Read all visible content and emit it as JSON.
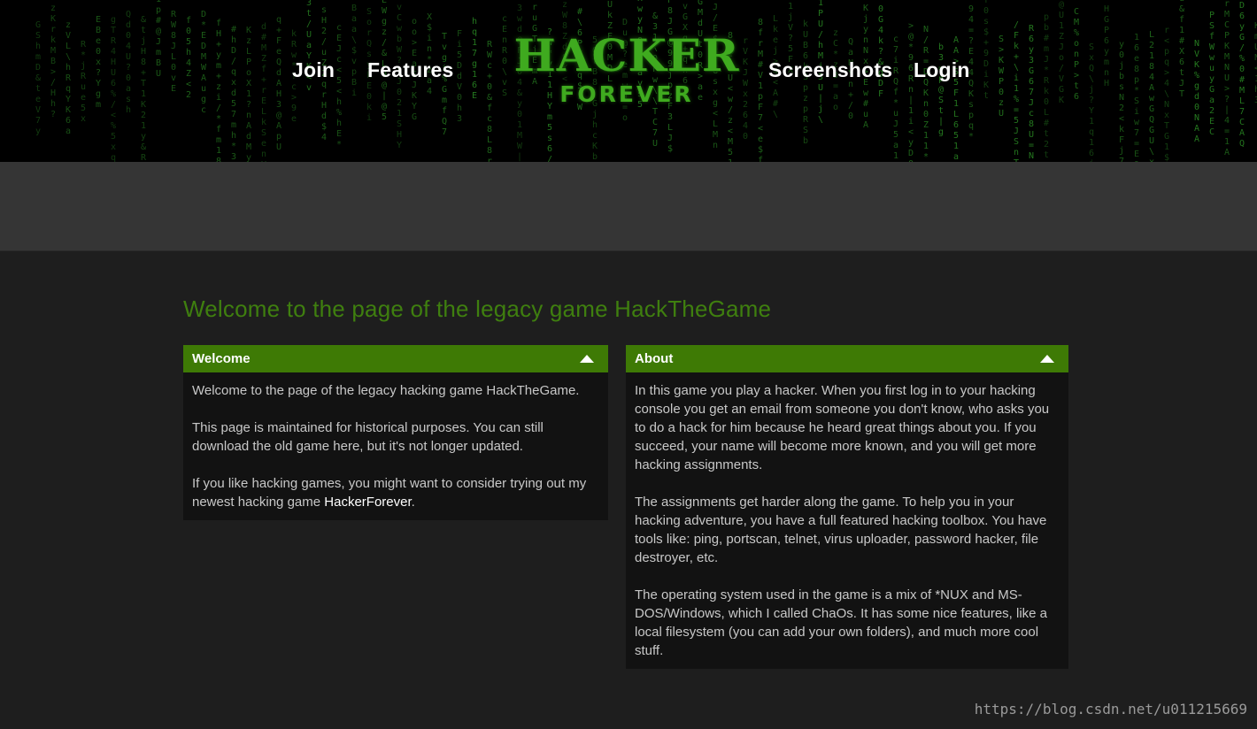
{
  "nav": {
    "join": "Join",
    "features": "Features",
    "screenshots": "Screenshots",
    "login": "Login"
  },
  "logo": {
    "main": "HACKER",
    "sub": "FOREVER"
  },
  "page_heading": "Welcome to the page of the legacy game HackTheGame",
  "welcome_panel": {
    "title": "Welcome",
    "p1": "Welcome to the page of the legacy hacking game HackTheGame.",
    "p2": "This page is maintained for historical purposes. You can still download the old game here, but it's not longer updated.",
    "p3_prefix": "If you like hacking games, you might want to consider trying out my newest hacking game ",
    "p3_link": "HackerForever",
    "p3_suffix": "."
  },
  "about_panel": {
    "title": "About",
    "p1": "In this game you play a hacker. When you first log in to your hacking console you get an email from someone you don't know, who asks you to do a hack for him because he heard great things about you. If you succeed, your name will become more known, and you will get more hacking assignments.",
    "p2": "The assignments get harder along the game. To help you in your hacking adventure, you have a full featured hacking toolbox. You have tools like: ping, portscan, telnet, virus uploader, password hacker, file destroyer, etc.",
    "p3": "The operating system used in the game is a mix of *NUX and MS-DOS/Windows, which I called ChaOs. It has some nice features, like a local filesystem (you can add your own folders), and much more cool stuff."
  },
  "watermark": "https://blog.csdn.net/u011215669",
  "colors": {
    "accent_green": "#3e7a05",
    "heading_green": "#3f7f0f",
    "logo_green": "#3faa1f"
  },
  "icons": {
    "panel_toggle": "caret-up-icon"
  }
}
